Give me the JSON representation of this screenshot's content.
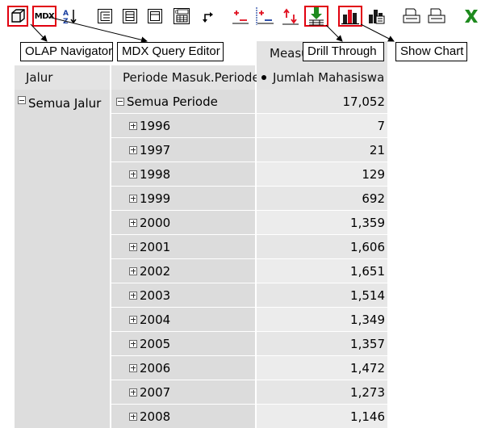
{
  "toolbar": {
    "mdx_button_label": "MDX",
    "buttons": [
      {
        "icon": "cube-icon",
        "highlighted": true
      },
      {
        "icon": "mdx-icon",
        "highlighted": true
      },
      {
        "icon": "sort-az-icon"
      },
      {
        "icon": "hierarchy-icon"
      },
      {
        "icon": "columns-icon"
      },
      {
        "icon": "properties-icon"
      },
      {
        "icon": "table-options-icon"
      },
      {
        "icon": "swap-axes-icon"
      },
      {
        "icon": "drill-member-icon"
      },
      {
        "icon": "drill-position-icon"
      },
      {
        "icon": "drill-replace-icon"
      },
      {
        "icon": "drill-through-icon",
        "highlighted": true
      },
      {
        "icon": "bar-chart-icon",
        "highlighted": true
      },
      {
        "icon": "chart-config-icon"
      },
      {
        "icon": "print-config-icon"
      },
      {
        "icon": "print-pdf-icon"
      },
      {
        "icon": "excel-export-icon"
      }
    ],
    "colors": {
      "highlight": "#e1000f",
      "drill_red": "#e01020",
      "drill_green": "#1e8a1e",
      "chart_dark": "#1a1a1a"
    }
  },
  "callouts": {
    "olap_navigator": "OLAP Navigator",
    "mdx_query_editor": "MDX Query Editor",
    "drill_through": "Drill Through",
    "show_chart": "Show Chart"
  },
  "table": {
    "measures_header": "Measu",
    "col_headers": {
      "jalur": "Jalur",
      "periode": "Periode Masuk.Periode",
      "measure": "Jumlah Mahasiswa"
    },
    "root_row": {
      "jalur": "Semua Jalur",
      "periode": "Semua Periode",
      "value": "17,052"
    },
    "rows": [
      {
        "periode": "1996",
        "value": "7"
      },
      {
        "periode": "1997",
        "value": "21"
      },
      {
        "periode": "1998",
        "value": "129"
      },
      {
        "periode": "1999",
        "value": "692"
      },
      {
        "periode": "2000",
        "value": "1,359"
      },
      {
        "periode": "2001",
        "value": "1,606"
      },
      {
        "periode": "2002",
        "value": "1,651"
      },
      {
        "periode": "2003",
        "value": "1,514"
      },
      {
        "periode": "2004",
        "value": "1,349"
      },
      {
        "periode": "2005",
        "value": "1,357"
      },
      {
        "periode": "2006",
        "value": "1,472"
      },
      {
        "periode": "2007",
        "value": "1,273"
      },
      {
        "periode": "2008",
        "value": "1,146"
      }
    ]
  }
}
